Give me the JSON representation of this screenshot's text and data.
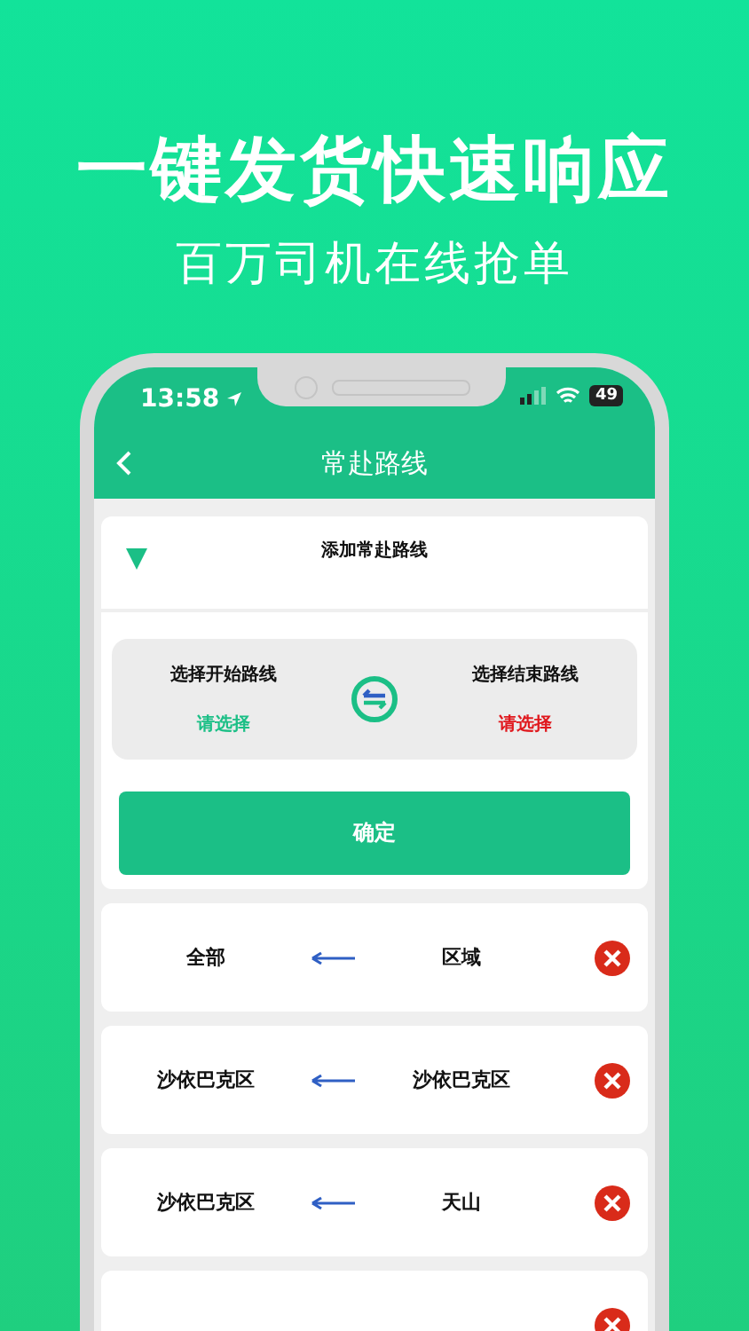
{
  "headline": "一键发货快速响应",
  "subheadline": "百万司机在线抢单",
  "status_bar": {
    "time": "13:58",
    "battery": "49"
  },
  "nav": {
    "title": "常赴路线"
  },
  "add_panel": {
    "title": "添加常赴路线",
    "expanded": true,
    "start": {
      "label": "选择开始路线",
      "value": "请选择"
    },
    "end": {
      "label": "选择结束路线",
      "value": "请选择"
    },
    "confirm": "确定"
  },
  "routes": [
    {
      "kind": "full",
      "from": "全部",
      "to": "区域"
    },
    {
      "kind": "full",
      "from": "沙依巴克区",
      "to": "沙依巴克区"
    },
    {
      "kind": "full",
      "from": "沙依巴克区",
      "to": "天山"
    },
    {
      "kind": "cut_off"
    }
  ]
}
